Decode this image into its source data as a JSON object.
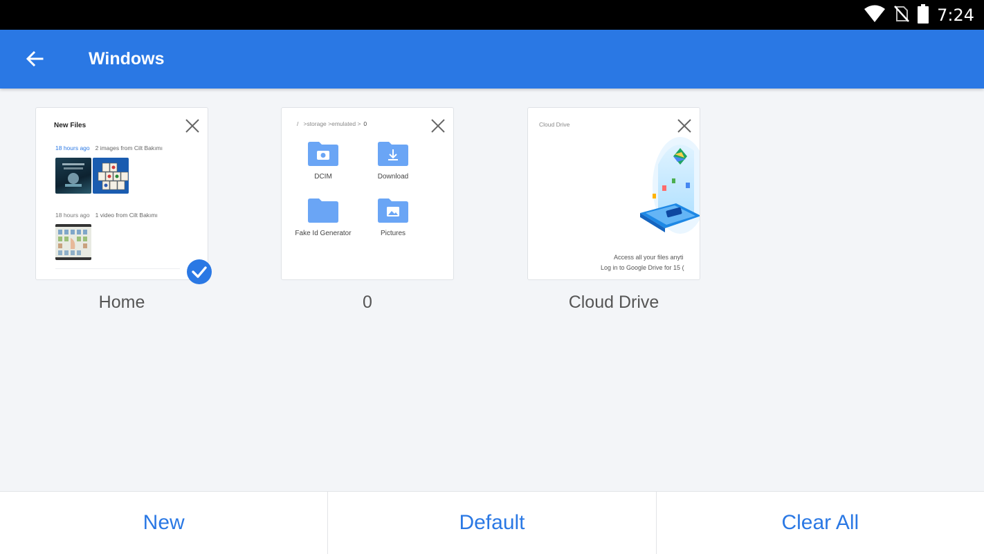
{
  "status_bar": {
    "time": "7:24",
    "icons": [
      "wifi-icon",
      "no-sim-icon",
      "battery-icon"
    ]
  },
  "app_bar": {
    "title": "Windows",
    "back_icon": "arrow-back-icon"
  },
  "windows": [
    {
      "label": "Home",
      "selected": true,
      "content": {
        "title": "New Files",
        "groups": [
          {
            "time": "18 hours ago",
            "description": "2 images from Cilt Bakımı"
          },
          {
            "time": "18 hours ago",
            "description": "1 video from Cilt Bakımı"
          }
        ]
      }
    },
    {
      "label": "0",
      "selected": false,
      "content": {
        "breadcrumb": [
          "/",
          "storage",
          "emulated",
          "0"
        ],
        "folders": [
          {
            "name": "DCIM",
            "icon": "camera-folder-icon"
          },
          {
            "name": "Download",
            "icon": "download-folder-icon"
          },
          {
            "name": "Fake Id Generator",
            "icon": "folder-icon"
          },
          {
            "name": "Pictures",
            "icon": "pictures-folder-icon"
          }
        ]
      }
    },
    {
      "label": "Cloud Drive",
      "selected": false,
      "content": {
        "title": "Cloud Drive",
        "line1": "Access all your files anyti",
        "line2": "Log in to Google Drive for 15 ("
      }
    }
  ],
  "bottom_bar": {
    "new_label": "New",
    "default_label": "Default",
    "clear_all_label": "Clear All"
  },
  "colors": {
    "accent": "#2a78e4",
    "background": "#f3f5f8",
    "folder": "#6aa5f5"
  }
}
